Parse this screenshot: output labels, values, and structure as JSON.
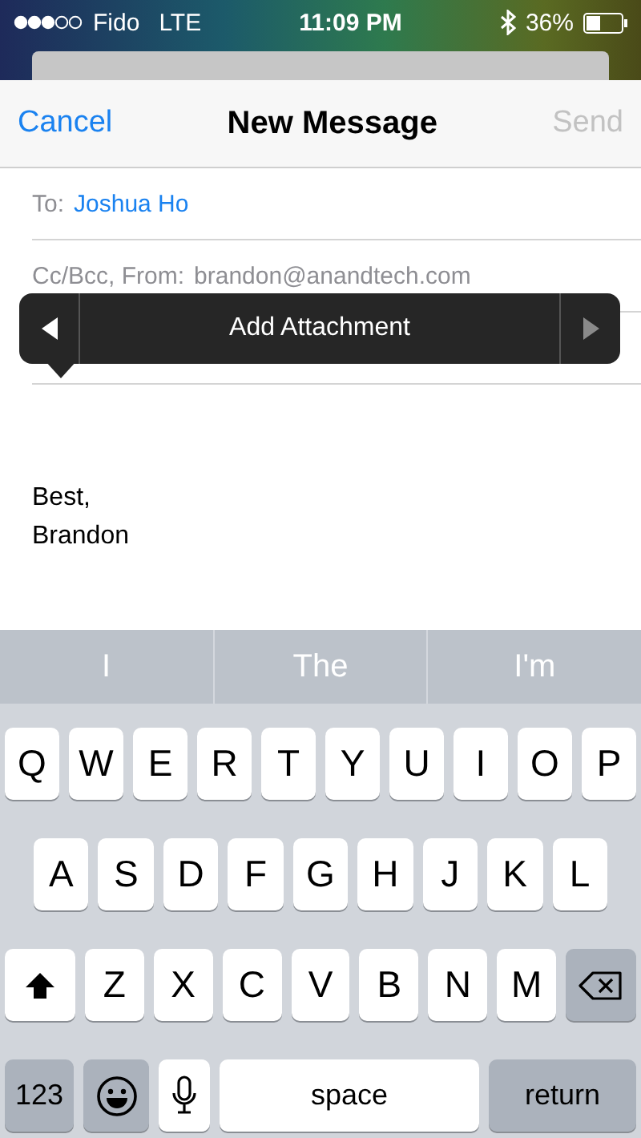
{
  "status_bar": {
    "carrier": "Fido",
    "network": "LTE",
    "time": "11:09 PM",
    "battery": "36%"
  },
  "nav": {
    "cancel": "Cancel",
    "title": "New Message",
    "send": "Send",
    "send_disabled": true
  },
  "fields": [
    {
      "label": "To:",
      "value": "Joshua Ho",
      "kind": "recipient"
    },
    {
      "label": "Cc/Bcc, From:",
      "value": "brandon@anandtech.com",
      "kind": "plain"
    },
    {
      "kind": "blank"
    }
  ],
  "popup": {
    "label": "Add Attachment",
    "prev_disabled": false,
    "next_disabled": true
  },
  "body": [
    "Best,",
    "Brandon"
  ],
  "suggestions": [
    "I",
    "The",
    "I'm"
  ],
  "keyboard": {
    "rows": [
      {
        "keys": [
          {
            "kind": "letter",
            "label": "Q"
          },
          {
            "kind": "letter",
            "label": "W"
          },
          {
            "kind": "letter",
            "label": "E"
          },
          {
            "kind": "letter",
            "label": "R"
          },
          {
            "kind": "letter",
            "label": "T"
          },
          {
            "kind": "letter",
            "label": "Y"
          },
          {
            "kind": "letter",
            "label": "U"
          },
          {
            "kind": "letter",
            "label": "I"
          },
          {
            "kind": "letter",
            "label": "O"
          },
          {
            "kind": "letter",
            "label": "P"
          }
        ]
      },
      {
        "keys": [
          {
            "kind": "letter",
            "label": "A"
          },
          {
            "kind": "letter",
            "label": "S"
          },
          {
            "kind": "letter",
            "label": "D"
          },
          {
            "kind": "letter",
            "label": "F"
          },
          {
            "kind": "letter",
            "label": "G"
          },
          {
            "kind": "letter",
            "label": "H"
          },
          {
            "kind": "letter",
            "label": "J"
          },
          {
            "kind": "letter",
            "label": "K"
          },
          {
            "kind": "letter",
            "label": "L"
          }
        ]
      },
      {
        "keys": [
          {
            "kind": "shift"
          },
          {
            "kind": "letter",
            "label": "Z"
          },
          {
            "kind": "letter",
            "label": "X"
          },
          {
            "kind": "letter",
            "label": "C"
          },
          {
            "kind": "letter",
            "label": "V"
          },
          {
            "kind": "letter",
            "label": "B"
          },
          {
            "kind": "letter",
            "label": "N"
          },
          {
            "kind": "letter",
            "label": "M"
          },
          {
            "kind": "delete"
          }
        ]
      },
      {
        "keys": [
          {
            "kind": "numbers",
            "label": "123"
          },
          {
            "kind": "emoji"
          },
          {
            "kind": "mic"
          },
          {
            "kind": "space",
            "label": "space"
          },
          {
            "kind": "return",
            "label": "return"
          }
        ]
      }
    ]
  }
}
